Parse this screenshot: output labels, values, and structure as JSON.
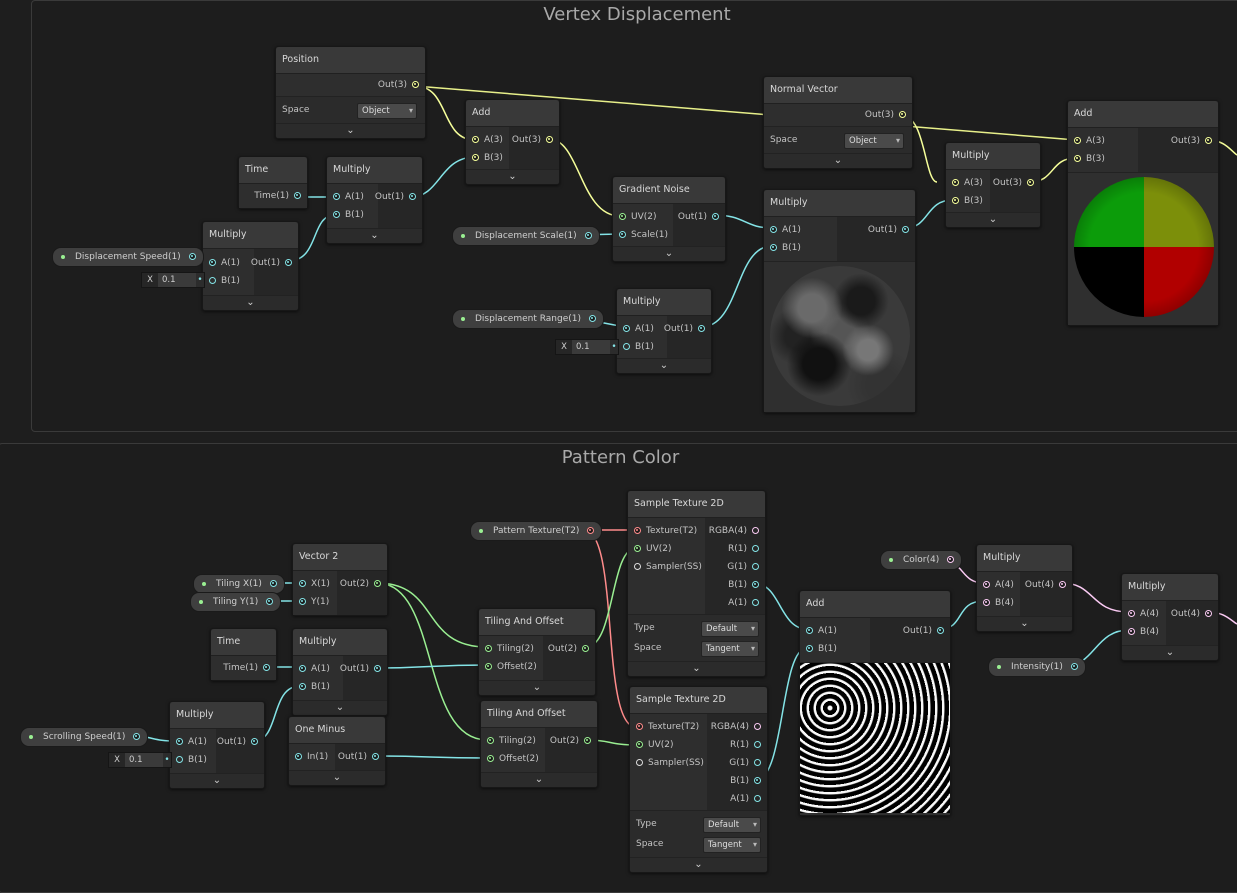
{
  "groups": {
    "vertex": "Vertex Displacement",
    "pattern": "Pattern Color"
  },
  "vd": {
    "position": {
      "title": "Position",
      "out": "Out(3)",
      "space_label": "Space",
      "space_value": "Object"
    },
    "time": {
      "title": "Time",
      "out": "Time(1)"
    },
    "multiply_time": {
      "title": "Multiply",
      "a": "A(1)",
      "b": "B(1)",
      "out": "Out(1)"
    },
    "multiply_speed": {
      "title": "Multiply",
      "a": "A(1)",
      "b": "B(1)",
      "out": "Out(1)"
    },
    "add1": {
      "title": "Add",
      "a": "A(3)",
      "b": "B(3)",
      "out": "Out(3)"
    },
    "gradient_noise": {
      "title": "Gradient Noise",
      "uv": "UV(2)",
      "scale": "Scale(1)",
      "out": "Out(1)"
    },
    "multiply_range": {
      "title": "Multiply",
      "a": "A(1)",
      "b": "B(1)",
      "out": "Out(1)"
    },
    "multiply_noise": {
      "title": "Multiply",
      "a": "A(1)",
      "b": "B(1)",
      "out": "Out(1)"
    },
    "normal_vector": {
      "title": "Normal Vector",
      "out": "Out(3)",
      "space_label": "Space",
      "space_value": "Object"
    },
    "multiply_normal": {
      "title": "Multiply",
      "a": "A(3)",
      "b": "B(3)",
      "out": "Out(3)"
    },
    "add_final": {
      "title": "Add",
      "a": "A(3)",
      "b": "B(3)",
      "out": "Out(3)"
    },
    "displacement_speed": "Displacement Speed(1)",
    "displacement_scale": "Displacement Scale(1)",
    "displacement_range": "Displacement Range(1)",
    "inline_x": "X",
    "inline_val": "0.1"
  },
  "pc": {
    "pattern_texture": "Pattern Texture(T2)",
    "tiling_x": "Tiling X(1)",
    "tiling_y": "Tiling Y(1)",
    "scrolling_speed": "Scrolling Speed(1)",
    "color": "Color(4)",
    "intensity": "Intensity(1)",
    "inline_x": "X",
    "inline_val": "0.1",
    "vector2": {
      "title": "Vector 2",
      "x": "X(1)",
      "y": "Y(1)",
      "out": "Out(2)"
    },
    "time": {
      "title": "Time",
      "out": "Time(1)"
    },
    "multiply_time": {
      "title": "Multiply",
      "a": "A(1)",
      "b": "B(1)",
      "out": "Out(1)"
    },
    "multiply_speed": {
      "title": "Multiply",
      "a": "A(1)",
      "b": "B(1)",
      "out": "Out(1)"
    },
    "one_minus": {
      "title": "One Minus",
      "in": "In(1)",
      "out": "Out(1)"
    },
    "tiling_offset1": {
      "title": "Tiling And Offset",
      "tiling": "Tiling(2)",
      "offset": "Offset(2)",
      "out": "Out(2)"
    },
    "tiling_offset2": {
      "title": "Tiling And Offset",
      "tiling": "Tiling(2)",
      "offset": "Offset(2)",
      "out": "Out(2)"
    },
    "sample1": {
      "title": "Sample Texture 2D",
      "texture": "Texture(T2)",
      "uv": "UV(2)",
      "sampler": "Sampler(SS)",
      "rgba": "RGBA(4)",
      "r": "R(1)",
      "g": "G(1)",
      "b": "B(1)",
      "a": "A(1)",
      "type_label": "Type",
      "type_value": "Default",
      "space_label": "Space",
      "space_value": "Tangent"
    },
    "sample2": {
      "title": "Sample Texture 2D",
      "texture": "Texture(T2)",
      "uv": "UV(2)",
      "sampler": "Sampler(SS)",
      "rgba": "RGBA(4)",
      "r": "R(1)",
      "g": "G(1)",
      "b": "B(1)",
      "a": "A(1)",
      "type_label": "Type",
      "type_value": "Default",
      "space_label": "Space",
      "space_value": "Tangent"
    },
    "add": {
      "title": "Add",
      "a": "A(1)",
      "b": "B(1)",
      "out": "Out(1)"
    },
    "multiply_color": {
      "title": "Multiply",
      "a": "A(4)",
      "b": "B(4)",
      "out": "Out(4)"
    },
    "multiply_final": {
      "title": "Multiply",
      "a": "A(4)",
      "b": "B(4)",
      "out": "Out(4)"
    }
  },
  "footer_glyph": "⌄",
  "colors": {
    "float": "#84e4e7",
    "vec2": "#9aef92",
    "vec3": "#f6ff9a",
    "vec4": "#fbcbf4",
    "texture": "#ff8b8b"
  }
}
